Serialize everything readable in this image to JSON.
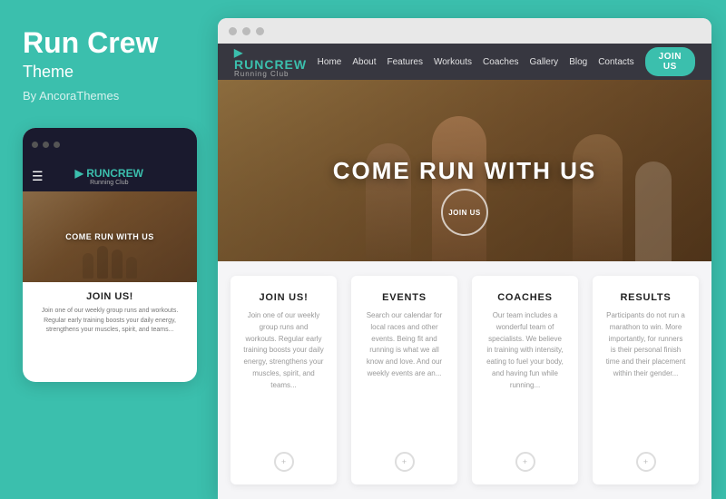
{
  "left": {
    "title": "Run Crew",
    "subtitle": "Theme",
    "author": "By AncoraThemes"
  },
  "mobile": {
    "logo": "RUNCREW",
    "logo_arrow": "▶",
    "logo_sub": "Running Club",
    "hero_text": "COME RUN WITH US",
    "join_title": "JOIN US!",
    "join_text": "Join one of our weekly group runs and workouts. Regular early training boosts your daily energy, strengthens your muscles, spirit, and teams..."
  },
  "browser": {
    "dots": [
      "dot1",
      "dot2",
      "dot3"
    ]
  },
  "nav": {
    "logo": "RUNCREW",
    "logo_arrow": "▶",
    "logo_sub": "Running Club",
    "links": [
      "Home",
      "About",
      "Features",
      "Workouts",
      "Coaches",
      "Gallery",
      "Blog",
      "Contacts"
    ],
    "join_btn": "JOIN US"
  },
  "hero": {
    "title": "COME RUN WITH US",
    "join_btn": "JOIN US"
  },
  "cards": [
    {
      "title": "JOIN US!",
      "text": "Join one of our weekly group runs and workouts. Regular early training boosts your daily energy, strengthens your muscles, spirit, and teams..."
    },
    {
      "title": "EVENTS",
      "text": "Search our calendar for local races and other events. Being fit and running is what we all know and love. And our weekly events are an..."
    },
    {
      "title": "COACHES",
      "text": "Our team includes a wonderful team of specialists. We believe in training with intensity, eating to fuel your body, and having fun while running..."
    },
    {
      "title": "RESULTS",
      "text": "Participants do not run a marathon to win. More importantly, for runners is their personal finish time and their placement within their gender..."
    }
  ]
}
